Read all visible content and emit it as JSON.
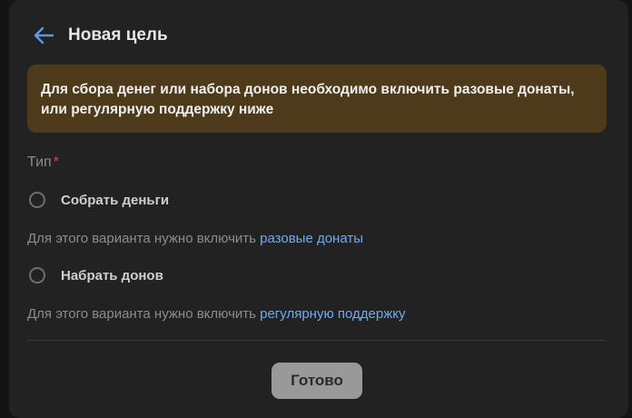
{
  "header": {
    "title": "Новая цель",
    "back_icon": "arrow-left-icon"
  },
  "warning": {
    "text": "Для сбора денег или набора донов необходимо включить разовые донаты, или регулярную поддержку ниже"
  },
  "type": {
    "label": "Тип",
    "required_mark": "*",
    "options": [
      {
        "label": "Собрать деньги",
        "selected": false,
        "hint_text": "Для этого варианта нужно включить ",
        "hint_link": "разовые донаты"
      },
      {
        "label": "Набрать донов",
        "selected": false,
        "hint_text": "Для этого варианта нужно включить ",
        "hint_link": "регулярную поддержку"
      }
    ]
  },
  "footer": {
    "done_label": "Готово"
  },
  "colors": {
    "background": "#222222",
    "warning_bg": "#4d3a1a",
    "link": "#71aaeb",
    "accent": "#5a9ae6",
    "required": "#e0443e",
    "button_bg": "#999999"
  }
}
